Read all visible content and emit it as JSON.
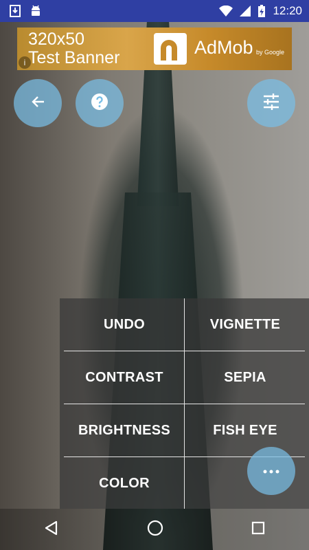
{
  "status_bar": {
    "time": "12:20",
    "icons": [
      "download-icon",
      "android-icon",
      "wifi-icon",
      "signal-icon",
      "battery-charging-icon"
    ]
  },
  "ad": {
    "line1": "320x50",
    "line2": "Test Banner",
    "brand": "AdMob",
    "by": "by Google",
    "info": "i"
  },
  "toolbar": {
    "buttons": [
      "back-arrow-icon",
      "help-icon",
      "sliders-icon"
    ]
  },
  "menu": {
    "items": [
      "UNDO",
      "VIGNETTE",
      "CONTRAST",
      "SEPIA",
      "BRIGHTNESS",
      "FISH EYE",
      "COLOR"
    ]
  },
  "more_button": {
    "icon": "more-horiz-icon",
    "label": "•••"
  },
  "nav_bar": {
    "buttons": [
      "back-triangle-icon",
      "home-circle-icon",
      "recents-square-icon"
    ]
  },
  "colors": {
    "status_bar": "#2f3fa3",
    "fab": "#78bee6",
    "menu_bg": "#373737"
  }
}
